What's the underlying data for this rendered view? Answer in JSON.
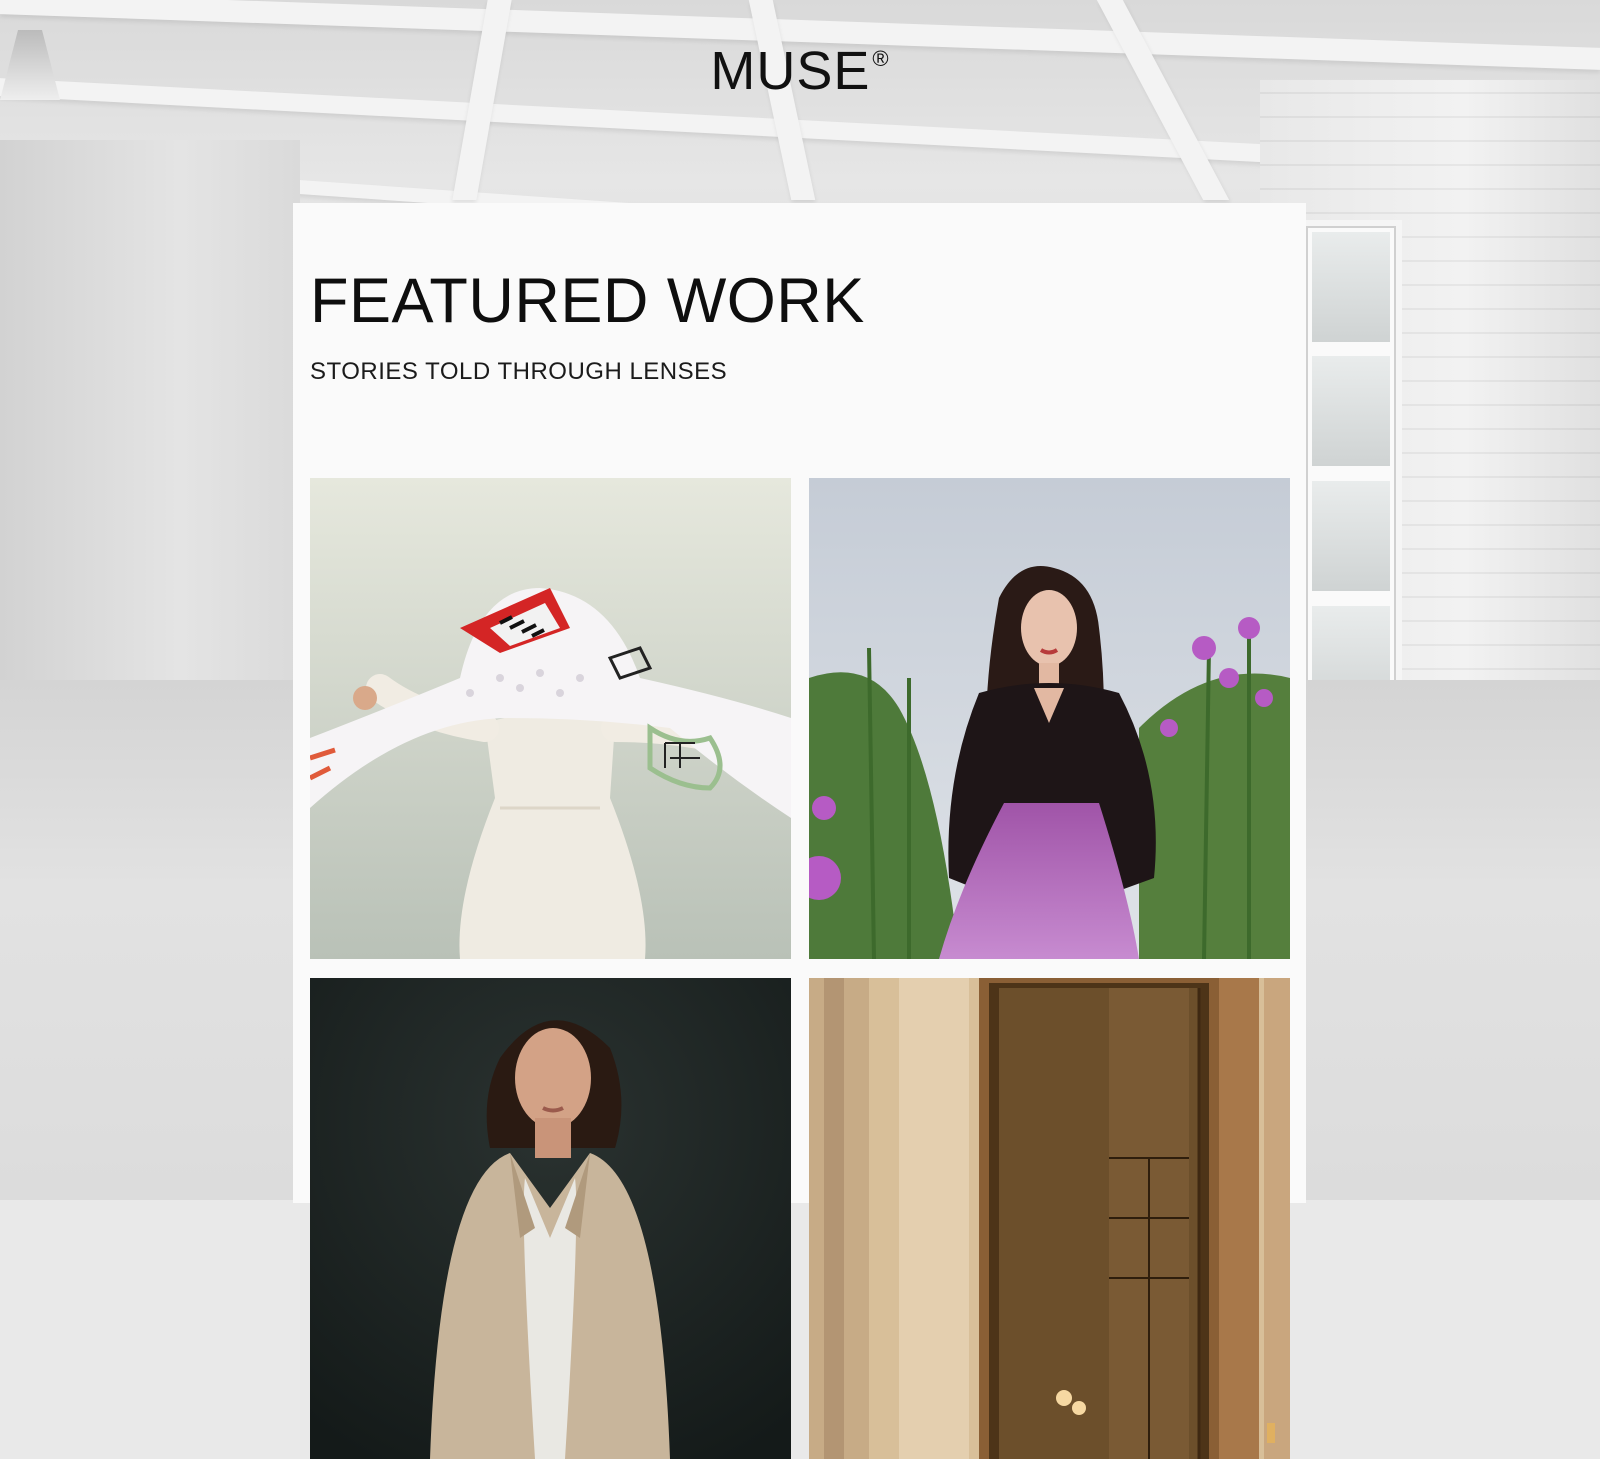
{
  "brand": {
    "name": "MUSE",
    "mark": "®"
  },
  "section": {
    "title": "FEATURED WORK",
    "subtitle": "STORIES TOLD THROUGH LENSES"
  },
  "gallery": {
    "items": [
      {
        "id": "scarf-white-dress",
        "subject": "figure holding patterned scarf over head, white dress"
      },
      {
        "id": "flower-field-portrait",
        "subject": "woman with long dark hair among purple flowers"
      },
      {
        "id": "beige-blazer-portrait",
        "subject": "woman in beige blazer, dark background"
      },
      {
        "id": "brass-doorway",
        "subject": "warm-toned doorway with glass panes"
      }
    ]
  },
  "colors": {
    "panel_bg": "#fafafa",
    "text": "#111111"
  }
}
